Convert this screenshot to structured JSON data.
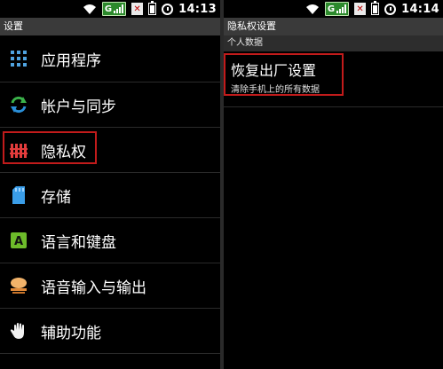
{
  "left": {
    "status": {
      "network": "G",
      "time": "14:13"
    },
    "title": "设置",
    "items": [
      {
        "label": "应用程序",
        "icon": "apps-grid-icon"
      },
      {
        "label": "帐户与同步",
        "icon": "sync-icon"
      },
      {
        "label": "隐私权",
        "icon": "privacy-fence-icon"
      },
      {
        "label": "存储",
        "icon": "storage-card-icon"
      },
      {
        "label": "语言和键盘",
        "icon": "language-keyboard-icon"
      },
      {
        "label": "语音输入与输出",
        "icon": "voice-io-icon"
      },
      {
        "label": "辅助功能",
        "icon": "accessibility-hand-icon"
      }
    ]
  },
  "right": {
    "status": {
      "network": "G",
      "time": "14:14"
    },
    "title": "隐私权设置",
    "section": "个人数据",
    "factory_reset": {
      "title": "恢复出厂设置",
      "subtitle": "清除手机上的所有数据"
    }
  },
  "colors": {
    "highlight": "#c21b1b",
    "titlebar": "#3a3a3a",
    "signal": "#2c8a2c"
  }
}
